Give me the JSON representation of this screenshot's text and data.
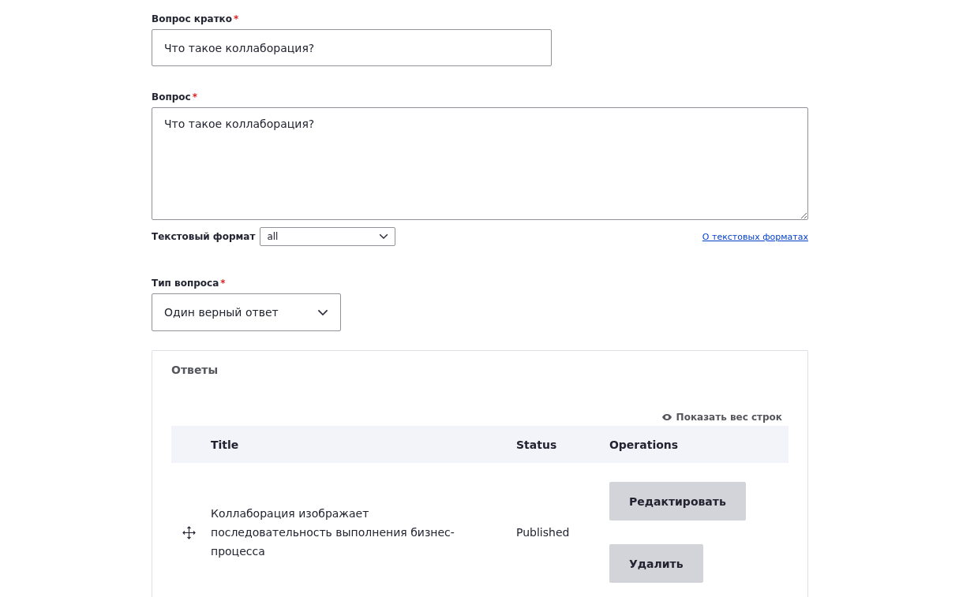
{
  "short_question": {
    "label": "Вопрос кратко",
    "required_mark": "*",
    "value": "Что такое коллаборация?"
  },
  "question": {
    "label": "Вопрос",
    "required_mark": "*",
    "value": "Что такое коллаборация?"
  },
  "text_format": {
    "label": "Текстовый формат",
    "value": "all",
    "help_link": "О текстовых форматах"
  },
  "question_type": {
    "label": "Тип вопроса",
    "required_mark": "*",
    "value": "Один верный ответ"
  },
  "answers": {
    "legend": "Ответы",
    "show_weights": "Показать вес строк",
    "columns": [
      "Title",
      "Status",
      "Operations"
    ],
    "rows": [
      {
        "title": "Коллаборация изображает последовательность выполнения бизнес-процесса",
        "status": "Published",
        "operations": [
          "Редактировать",
          "Удалить"
        ]
      }
    ]
  }
}
